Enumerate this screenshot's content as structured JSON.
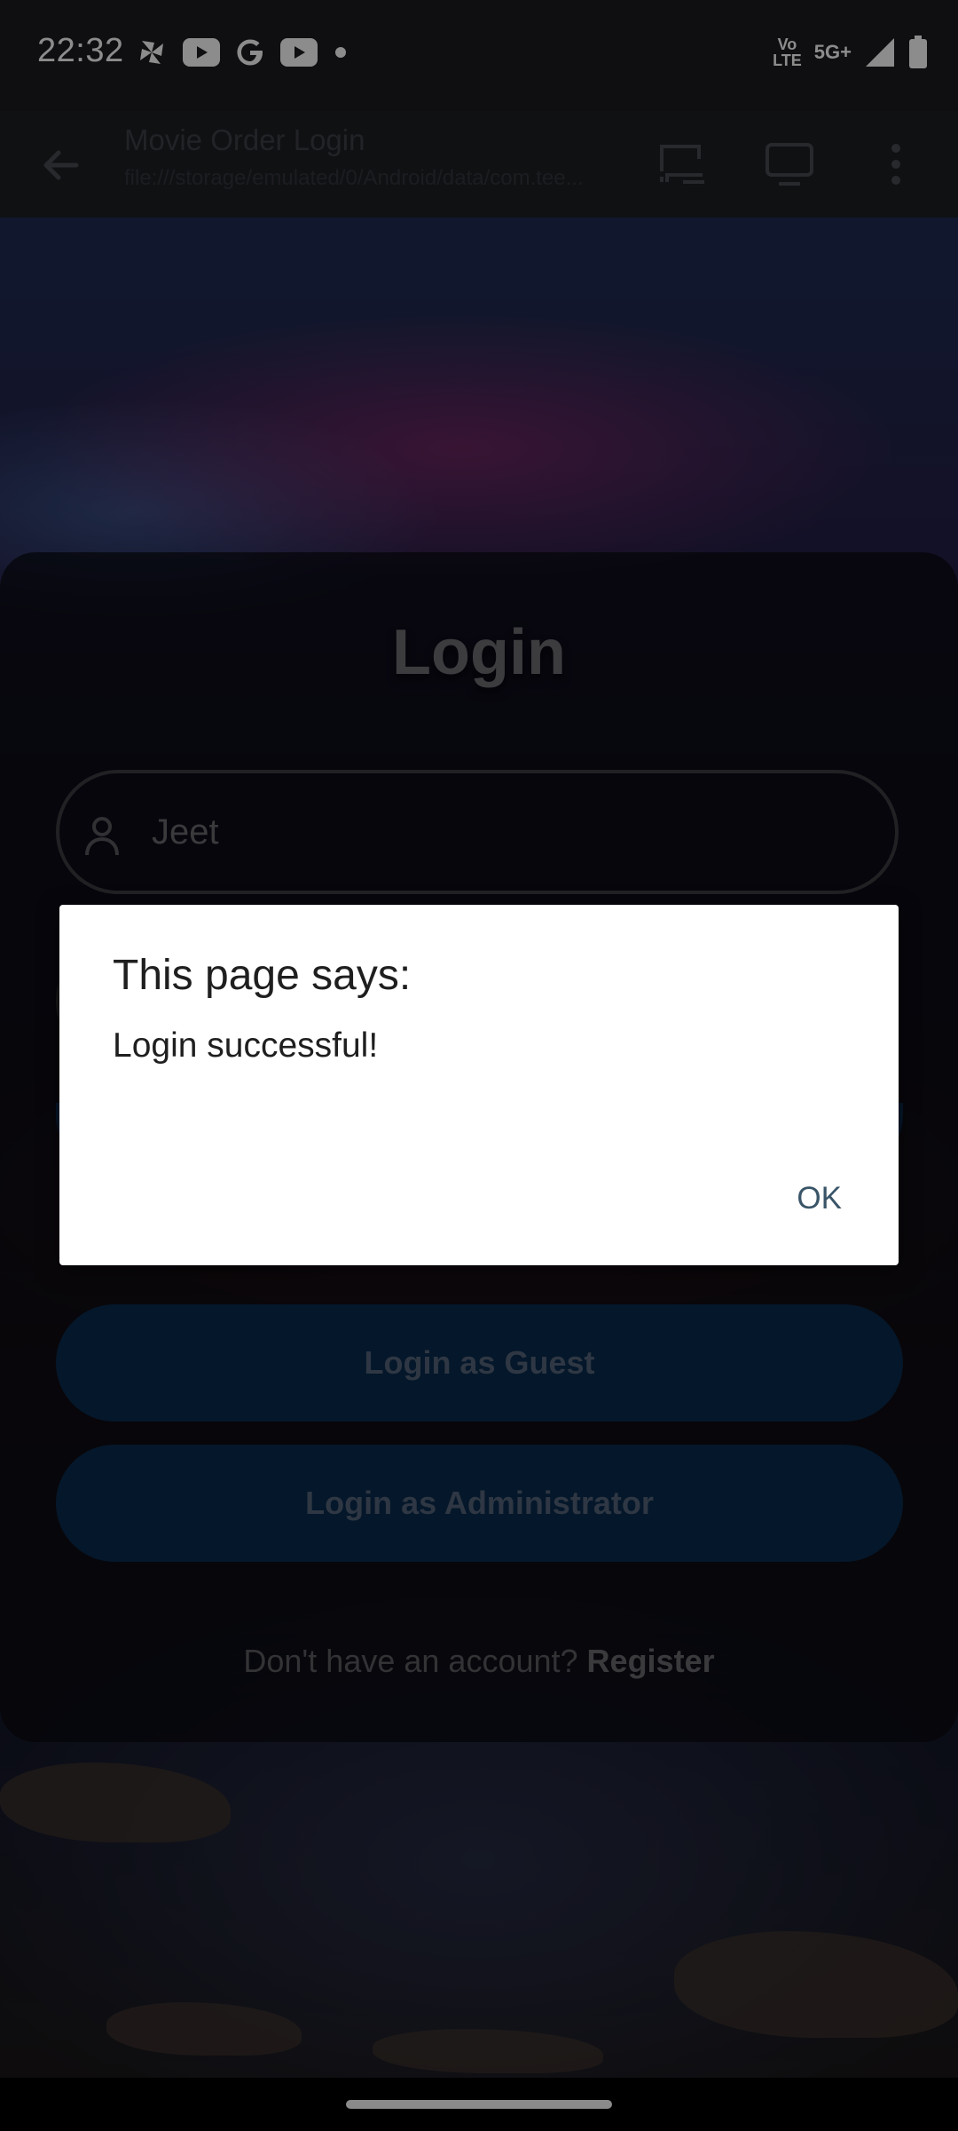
{
  "status_bar": {
    "time": "22:32",
    "notification_icons": [
      "pinwheel-icon",
      "youtube-icon",
      "google-icon",
      "youtube-icon",
      "dot-icon"
    ],
    "network_label_top": "Vo",
    "network_label_bottom": "LTE",
    "network_type": "5G+",
    "system_icons": [
      "volte-icon",
      "signal-icon",
      "battery-icon"
    ]
  },
  "browser": {
    "title": "Movie Order Login",
    "url": "file:///storage/emulated/0/Android/data/com.tee...",
    "icons": [
      "back-arrow-icon",
      "cast-icon",
      "desktop-site-icon",
      "more-vert-icon"
    ]
  },
  "login_card": {
    "heading": "Login",
    "username_value": "Jeet",
    "guest_button": "Login as Guest",
    "admin_button": "Login as Administrator",
    "register_prompt": "Don't have an account?",
    "register_link": "Register"
  },
  "dialog": {
    "title": "This page says:",
    "message": "Login successful!",
    "ok_button": "OK"
  },
  "colors": {
    "button_bg": "#0a2b4d",
    "dialog_ok": "#3a5568"
  }
}
